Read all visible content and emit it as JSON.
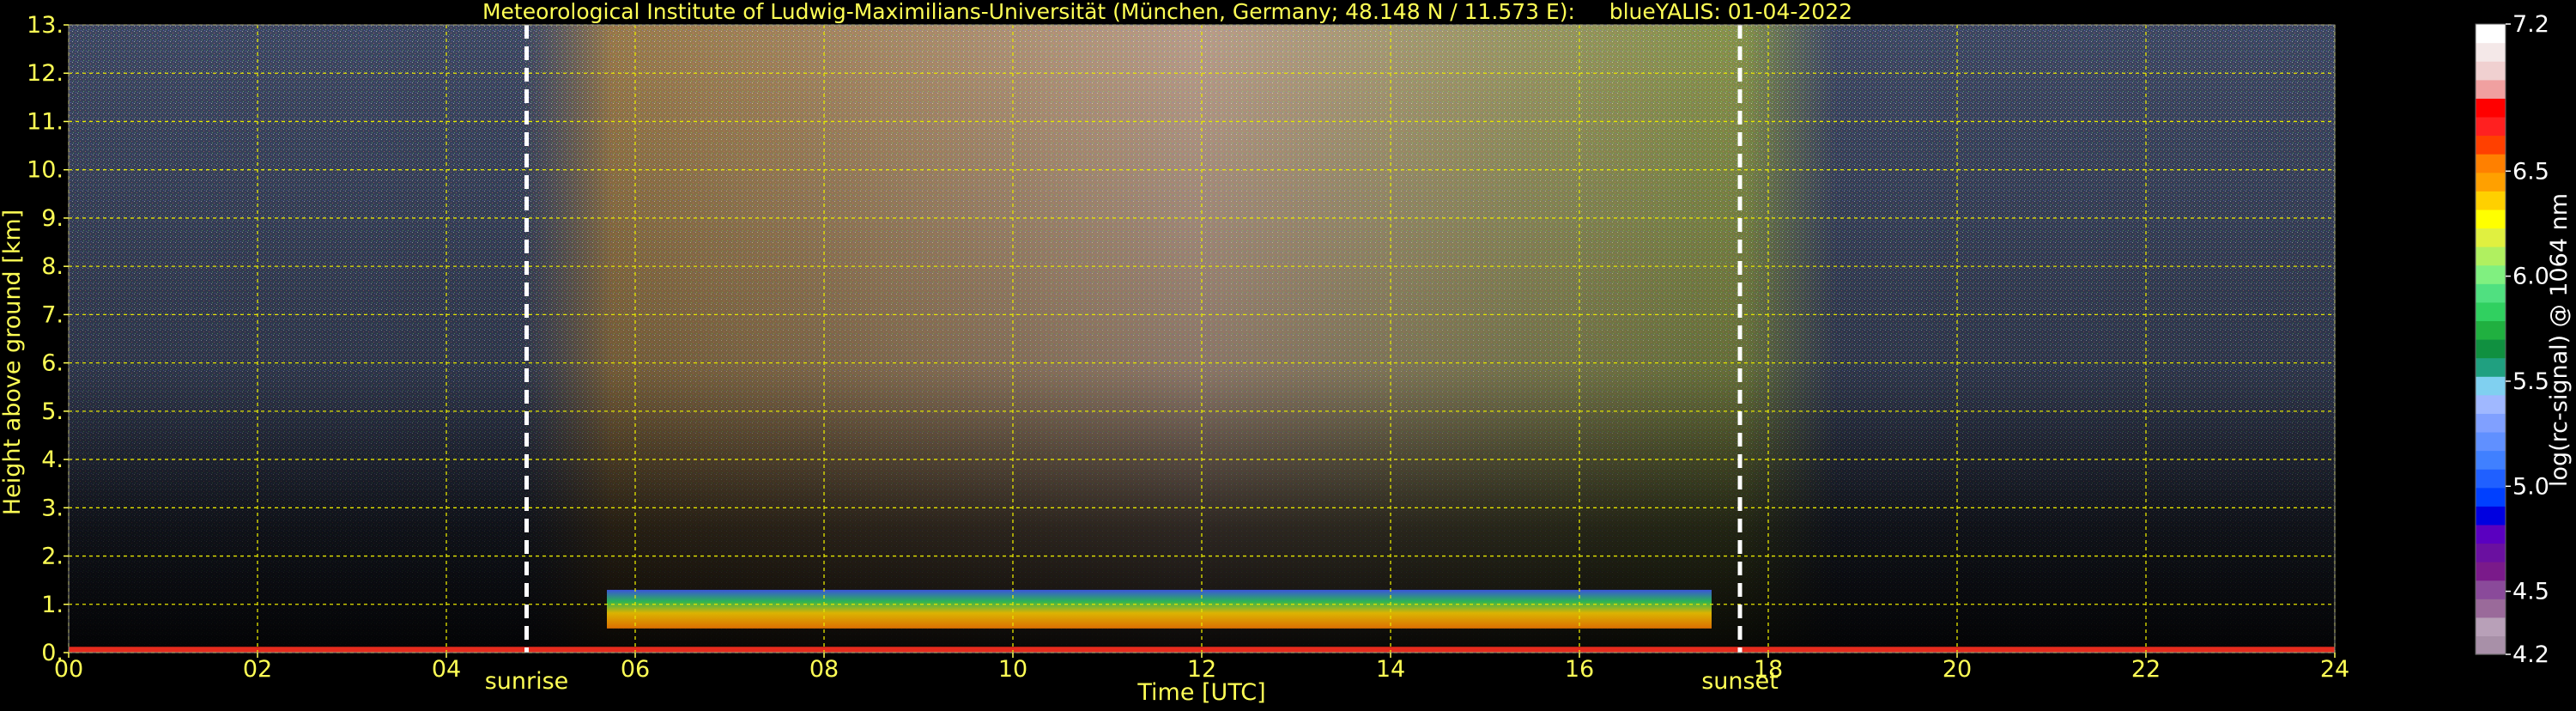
{
  "chart_data": {
    "type": "heatmap",
    "title": "Meteorological Institute of Ludwig-Maximilians-Universität (München, Germany; 48.148 N / 11.573 E):     blueYALIS: 01-04-2022",
    "xlabel": "Time [UTC]",
    "ylabel": "Height above ground [km]",
    "xlim": [
      0,
      24
    ],
    "ylim": [
      0,
      13
    ],
    "x_ticks": [
      "00",
      "02",
      "04",
      "06",
      "08",
      "10",
      "12",
      "14",
      "16",
      "18",
      "20",
      "22",
      "24"
    ],
    "y_ticks": [
      "0.",
      "1.",
      "2.",
      "3.",
      "4.",
      "5.",
      "6.",
      "7.",
      "8.",
      "9.",
      "10.",
      "11.",
      "12.",
      "13."
    ],
    "grid": true,
    "grid_color": "#e6e600",
    "markers": [
      {
        "label": "sunrise",
        "x": 4.85
      },
      {
        "label": "sunset",
        "x": 17.7
      }
    ],
    "colorbar": {
      "label": "log(rc-signal) @ 1064 nm",
      "range": [
        4.2,
        7.2
      ],
      "ticks": [
        "4.2",
        "4.5",
        "5.0",
        "5.5",
        "6.0",
        "6.5",
        "7.2"
      ],
      "colors": [
        "#a890a8",
        "#b8a0b8",
        "#9a6a9a",
        "#8a4a9a",
        "#7a1a8a",
        "#6a10a0",
        "#5a00c0",
        "#0000e0",
        "#0040ff",
        "#2060ff",
        "#4080ff",
        "#6090ff",
        "#80a0ff",
        "#a0b8ff",
        "#80d0f0",
        "#20a080",
        "#109040",
        "#20b040",
        "#30d060",
        "#50e080",
        "#80f080",
        "#b0f060",
        "#e0f040",
        "#ffff00",
        "#ffd000",
        "#ffa000",
        "#ff8000",
        "#ff4000",
        "#ff2020",
        "#ff0000",
        "#f0a0a0",
        "#f0d0d0",
        "#f4e8e8",
        "#ffffff"
      ]
    },
    "text_color": "#ffff55"
  }
}
